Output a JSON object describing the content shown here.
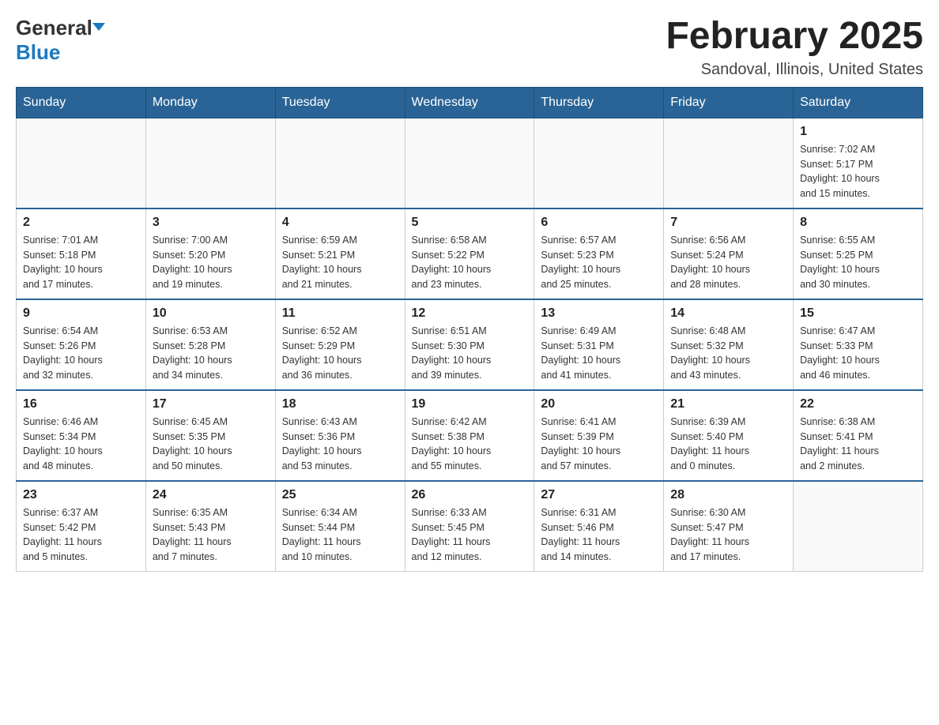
{
  "logo": {
    "general": "General",
    "blue": "Blue"
  },
  "title": "February 2025",
  "location": "Sandoval, Illinois, United States",
  "days_of_week": [
    "Sunday",
    "Monday",
    "Tuesday",
    "Wednesday",
    "Thursday",
    "Friday",
    "Saturday"
  ],
  "weeks": [
    {
      "days": [
        {
          "date": "",
          "info": ""
        },
        {
          "date": "",
          "info": ""
        },
        {
          "date": "",
          "info": ""
        },
        {
          "date": "",
          "info": ""
        },
        {
          "date": "",
          "info": ""
        },
        {
          "date": "",
          "info": ""
        },
        {
          "date": "1",
          "info": "Sunrise: 7:02 AM\nSunset: 5:17 PM\nDaylight: 10 hours\nand 15 minutes."
        }
      ]
    },
    {
      "days": [
        {
          "date": "2",
          "info": "Sunrise: 7:01 AM\nSunset: 5:18 PM\nDaylight: 10 hours\nand 17 minutes."
        },
        {
          "date": "3",
          "info": "Sunrise: 7:00 AM\nSunset: 5:20 PM\nDaylight: 10 hours\nand 19 minutes."
        },
        {
          "date": "4",
          "info": "Sunrise: 6:59 AM\nSunset: 5:21 PM\nDaylight: 10 hours\nand 21 minutes."
        },
        {
          "date": "5",
          "info": "Sunrise: 6:58 AM\nSunset: 5:22 PM\nDaylight: 10 hours\nand 23 minutes."
        },
        {
          "date": "6",
          "info": "Sunrise: 6:57 AM\nSunset: 5:23 PM\nDaylight: 10 hours\nand 25 minutes."
        },
        {
          "date": "7",
          "info": "Sunrise: 6:56 AM\nSunset: 5:24 PM\nDaylight: 10 hours\nand 28 minutes."
        },
        {
          "date": "8",
          "info": "Sunrise: 6:55 AM\nSunset: 5:25 PM\nDaylight: 10 hours\nand 30 minutes."
        }
      ]
    },
    {
      "days": [
        {
          "date": "9",
          "info": "Sunrise: 6:54 AM\nSunset: 5:26 PM\nDaylight: 10 hours\nand 32 minutes."
        },
        {
          "date": "10",
          "info": "Sunrise: 6:53 AM\nSunset: 5:28 PM\nDaylight: 10 hours\nand 34 minutes."
        },
        {
          "date": "11",
          "info": "Sunrise: 6:52 AM\nSunset: 5:29 PM\nDaylight: 10 hours\nand 36 minutes."
        },
        {
          "date": "12",
          "info": "Sunrise: 6:51 AM\nSunset: 5:30 PM\nDaylight: 10 hours\nand 39 minutes."
        },
        {
          "date": "13",
          "info": "Sunrise: 6:49 AM\nSunset: 5:31 PM\nDaylight: 10 hours\nand 41 minutes."
        },
        {
          "date": "14",
          "info": "Sunrise: 6:48 AM\nSunset: 5:32 PM\nDaylight: 10 hours\nand 43 minutes."
        },
        {
          "date": "15",
          "info": "Sunrise: 6:47 AM\nSunset: 5:33 PM\nDaylight: 10 hours\nand 46 minutes."
        }
      ]
    },
    {
      "days": [
        {
          "date": "16",
          "info": "Sunrise: 6:46 AM\nSunset: 5:34 PM\nDaylight: 10 hours\nand 48 minutes."
        },
        {
          "date": "17",
          "info": "Sunrise: 6:45 AM\nSunset: 5:35 PM\nDaylight: 10 hours\nand 50 minutes."
        },
        {
          "date": "18",
          "info": "Sunrise: 6:43 AM\nSunset: 5:36 PM\nDaylight: 10 hours\nand 53 minutes."
        },
        {
          "date": "19",
          "info": "Sunrise: 6:42 AM\nSunset: 5:38 PM\nDaylight: 10 hours\nand 55 minutes."
        },
        {
          "date": "20",
          "info": "Sunrise: 6:41 AM\nSunset: 5:39 PM\nDaylight: 10 hours\nand 57 minutes."
        },
        {
          "date": "21",
          "info": "Sunrise: 6:39 AM\nSunset: 5:40 PM\nDaylight: 11 hours\nand 0 minutes."
        },
        {
          "date": "22",
          "info": "Sunrise: 6:38 AM\nSunset: 5:41 PM\nDaylight: 11 hours\nand 2 minutes."
        }
      ]
    },
    {
      "days": [
        {
          "date": "23",
          "info": "Sunrise: 6:37 AM\nSunset: 5:42 PM\nDaylight: 11 hours\nand 5 minutes."
        },
        {
          "date": "24",
          "info": "Sunrise: 6:35 AM\nSunset: 5:43 PM\nDaylight: 11 hours\nand 7 minutes."
        },
        {
          "date": "25",
          "info": "Sunrise: 6:34 AM\nSunset: 5:44 PM\nDaylight: 11 hours\nand 10 minutes."
        },
        {
          "date": "26",
          "info": "Sunrise: 6:33 AM\nSunset: 5:45 PM\nDaylight: 11 hours\nand 12 minutes."
        },
        {
          "date": "27",
          "info": "Sunrise: 6:31 AM\nSunset: 5:46 PM\nDaylight: 11 hours\nand 14 minutes."
        },
        {
          "date": "28",
          "info": "Sunrise: 6:30 AM\nSunset: 5:47 PM\nDaylight: 11 hours\nand 17 minutes."
        },
        {
          "date": "",
          "info": ""
        }
      ]
    }
  ]
}
